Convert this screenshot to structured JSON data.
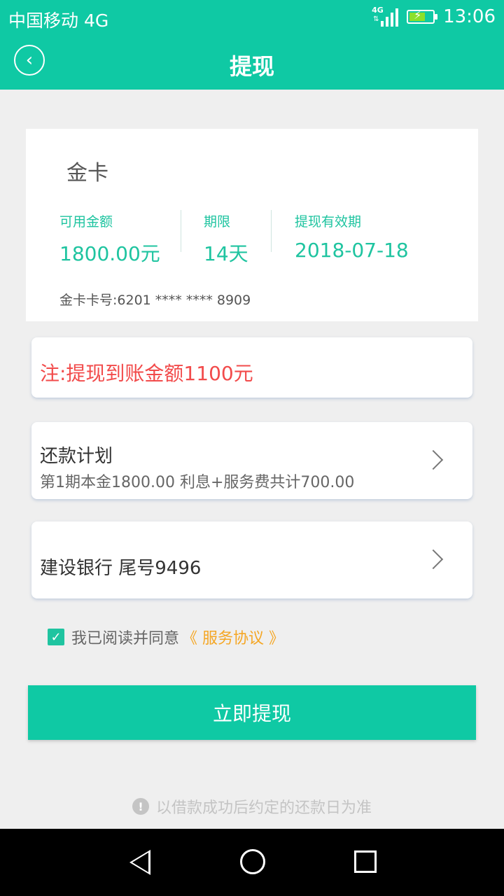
{
  "status_bar": {
    "carrier": "中国移动 4G",
    "network": "4G",
    "time": "13:06"
  },
  "header": {
    "title": "提现",
    "back_icon": "chevron-left-icon"
  },
  "card": {
    "name": "金卡",
    "available_label": "可用金额",
    "available_value": "1800.00元",
    "term_label": "期限",
    "term_value": "14天",
    "validity_label": "提现有效期",
    "validity_value": "2018-07-18",
    "card_number": "金卡卡号:6201 **** **** 8909"
  },
  "notice": {
    "text": "注:提现到账金额1100元"
  },
  "repayment_plan": {
    "title": "还款计划",
    "detail": "第1期本金1800.00  利息+服务费共计700.00"
  },
  "bank": {
    "text": "建设银行 尾号9496"
  },
  "agreement": {
    "checked": true,
    "text": "我已阅读并同意",
    "link": "《 服务协议 》"
  },
  "submit": {
    "label": "立即提现"
  },
  "footnote": {
    "text": "以借款成功后约定的还款日为准"
  },
  "colors": {
    "primary": "#0fc9a4",
    "warning": "#f24b4b",
    "link": "#f5a623"
  }
}
